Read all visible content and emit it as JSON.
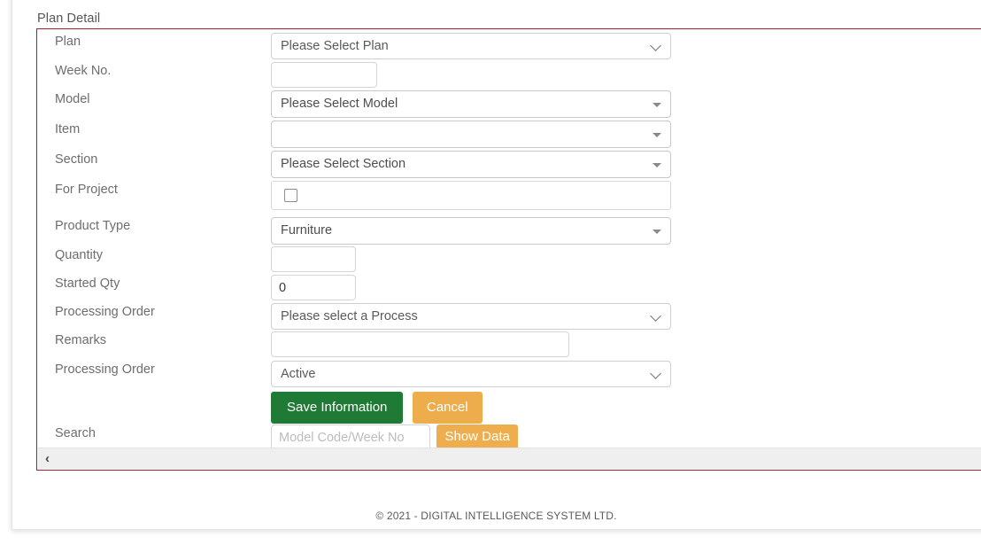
{
  "panel": {
    "title": "Plan Detail"
  },
  "form": {
    "rows": [
      {
        "label": "Plan",
        "control": "select-native",
        "value": "Please Select Plan"
      },
      {
        "label": "Week No.",
        "control": "input",
        "value": "",
        "placeholder": ""
      },
      {
        "label": "Model",
        "control": "select-custom",
        "value": "Please Select Model"
      },
      {
        "label": "Item",
        "control": "select-custom",
        "value": ""
      },
      {
        "label": "Section",
        "control": "select-custom",
        "value": "Please Select Section"
      },
      {
        "label": "For Project",
        "control": "checkbox",
        "checked": false
      },
      {
        "label": "Product Type",
        "control": "select-custom",
        "value": "Furniture"
      },
      {
        "label": "Quantity",
        "control": "input",
        "value": "",
        "placeholder": ""
      },
      {
        "label": "Started Qty",
        "control": "input",
        "value": "0",
        "placeholder": ""
      },
      {
        "label": "Processing Order",
        "control": "select-native",
        "value": "Please select a Process"
      },
      {
        "label": "Remarks",
        "control": "input",
        "value": "",
        "placeholder": ""
      },
      {
        "label": "Processing Order",
        "control": "select-native",
        "value": "Active"
      }
    ]
  },
  "actions": {
    "save_label": "Save Information",
    "cancel_label": "Cancel"
  },
  "search": {
    "label": "Search",
    "placeholder": "Model Code/Week No",
    "value": "",
    "button_label": "Show Data"
  },
  "scroll": {
    "left_arrow": "‹"
  },
  "footer": {
    "text": "© 2021 - DIGITAL INTELLIGENCE SYSTEM LTD."
  },
  "colors": {
    "frame_red": "#a61f2b",
    "save_green": "#1f7a35",
    "accent_orange": "#edad4d",
    "label_gray": "#6d6d6d"
  }
}
